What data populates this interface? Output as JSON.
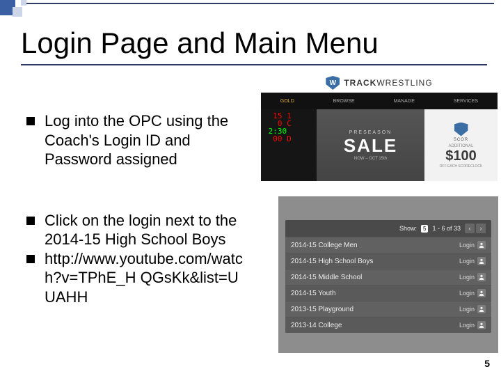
{
  "title": "Login Page and Main Menu",
  "bullets": [
    "Log into the OPC using the Coach's Login ID and Password assigned",
    "Click on the login next to the 2014-15 High School Boys",
    "http://www.youtube.com/watch?v=TPhE_H QGsKk&list=UUAHH"
  ],
  "page_number": "5",
  "tw": {
    "brand_bold": "TRACK",
    "brand_rest": "WRESTLING",
    "nav": [
      {
        "label": "GOLD",
        "active": true
      },
      {
        "label": "BROWSE",
        "active": false
      },
      {
        "label": "MANAGE",
        "active": false
      },
      {
        "label": "SERVICES",
        "active": false
      }
    ],
    "scoreboard": [
      "  15 1",
      "   0 C",
      " 2:30",
      "  00 D"
    ],
    "sale": {
      "pre": "PRESEASON",
      "big": "SALE",
      "sub": "NOW – OCT 15th"
    },
    "promo": {
      "scor": "SCOR",
      "additional": "ADDITIONAL",
      "amount": "$100",
      "off": "OFF EACH SCORECLOCK"
    }
  },
  "seasons": {
    "show_label": "Show:",
    "show_value": "5",
    "range": "1 - 6 of 33",
    "login_label": "Login",
    "rows": [
      "2014-15 College Men",
      "2014-15 High School Boys",
      "2014-15 Middle School",
      "2014-15 Youth",
      "2013-15 Playground",
      "2013-14 College"
    ]
  }
}
